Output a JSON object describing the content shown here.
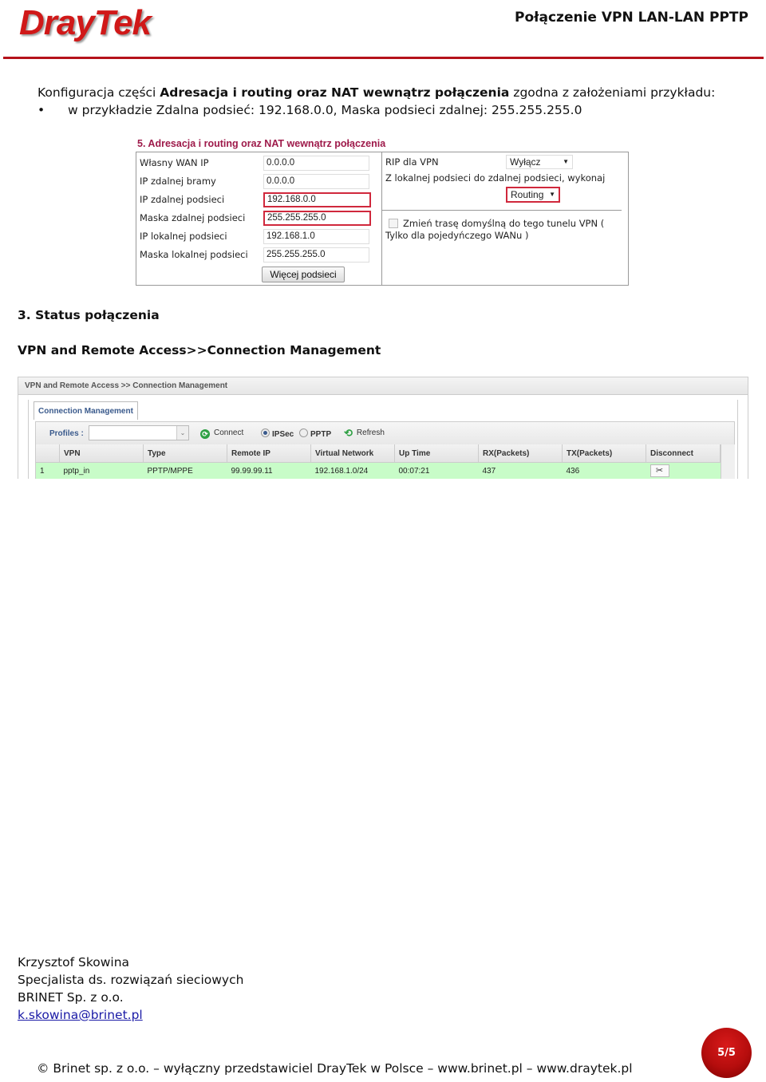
{
  "header": {
    "logo_text": "DrayTek",
    "doc_title": "Połączenie VPN LAN-LAN PPTP",
    "accent_color": "#b5121b"
  },
  "intro": {
    "prefix": "Konfiguracja części ",
    "bold": "Adresacja i routing oraz NAT wewnątrz połączenia",
    "suffix": " zgodna z założeniami przykładu:",
    "bullet_symbol": "•",
    "bullet_text": "w przykładzie Zdalna podsieć: 192.168.0.0, Maska podsieci zdalnej: 255.255.255.0"
  },
  "config_panel": {
    "title": "5. Adresacja i routing oraz NAT wewnątrz połączenia",
    "fields": [
      {
        "label": "Własny WAN IP",
        "value": "0.0.0.0",
        "highlighted": false
      },
      {
        "label": "IP zdalnej bramy",
        "value": "0.0.0.0",
        "highlighted": false
      },
      {
        "label": "IP zdalnej podsieci",
        "value": "192.168.0.0",
        "highlighted": true
      },
      {
        "label": "Maska zdalnej podsieci",
        "value": "255.255.255.0",
        "highlighted": true
      },
      {
        "label": "IP lokalnej podsieci",
        "value": "192.168.1.0",
        "highlighted": false
      },
      {
        "label": "Maska lokalnej podsieci",
        "value": "255.255.255.0",
        "highlighted": false
      }
    ],
    "more_button": "Więcej podsieci",
    "rip_label": "RIP dla VPN",
    "rip_value": "Wyłącz",
    "route_label": "Z lokalnej podsieci do zdalnej podsieci, wykonaj",
    "route_value": "Routing",
    "default_route_checked": false,
    "default_route_label": "Zmień trasę domyślną do tego tunelu VPN ( Tylko dla pojedyńczego WANu )",
    "highlight_color": "#d0283c"
  },
  "section3": {
    "heading": "3. Status połączenia",
    "path": "VPN  and Remote Access>>Connection Management"
  },
  "conn_mgmt": {
    "breadcrumb": "VPN and Remote Access >> Connection Management",
    "tab": "Connection Management",
    "profiles_label": "Profiles :",
    "profiles_value": "",
    "connect_label": "Connect",
    "radio_ipsec": "IPSec",
    "radio_pptp": "PPTP",
    "selected_radio": "IPSec",
    "refresh_label": "Refresh",
    "columns": [
      "",
      "VPN",
      "Type",
      "Remote IP",
      "Virtual Network",
      "Up Time",
      "RX(Packets)",
      "TX(Packets)",
      "Disconnect"
    ],
    "rows": [
      {
        "index": "1",
        "vpn": "pptp_in",
        "type": "PPTP/MPPE",
        "remote_ip": "99.99.99.11",
        "virtual_network": "192.168.1.0/24",
        "up_time": "00:07:21",
        "rx": "437",
        "tx": "436",
        "disconnect_icon": "scissors-icon"
      }
    ],
    "row_color": "#c8fcc8"
  },
  "signature": {
    "name": "Krzysztof Skowina",
    "role": "Specjalista ds. rozwiązań sieciowych",
    "company": "BRINET Sp. z o.o.",
    "email": "k.skowina@brinet.pl"
  },
  "footer": {
    "text": "© Brinet sp. z o.o. – wyłączny przedstawiciel DrayTek w Polsce – www.brinet.pl – www.draytek.pl",
    "page": "5/5"
  }
}
